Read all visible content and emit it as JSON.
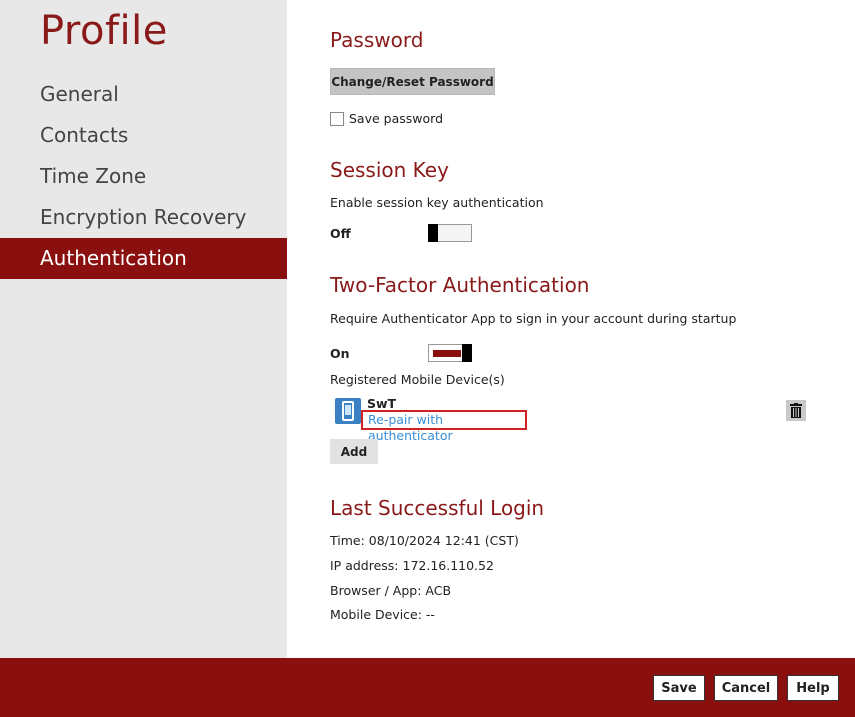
{
  "sidebar": {
    "title": "Profile",
    "items": [
      {
        "label": "General"
      },
      {
        "label": "Contacts"
      },
      {
        "label": "Time Zone"
      },
      {
        "label": "Encryption Recovery"
      },
      {
        "label": "Authentication",
        "active": true
      }
    ]
  },
  "password": {
    "title": "Password",
    "change_button": "Change/Reset Password",
    "save_password_label": "Save password",
    "save_password_checked": false
  },
  "session_key": {
    "title": "Session Key",
    "description": "Enable session key authentication",
    "state_label": "Off",
    "enabled": false
  },
  "two_factor": {
    "title": "Two-Factor Authentication",
    "description": "Require Authenticator App to sign in your account during startup",
    "state_label": "On",
    "enabled": true,
    "devices_label": "Registered Mobile Device(s)",
    "device": {
      "name": "SwT",
      "repair_link": "Re-pair with authenticator",
      "icon": "mobile-phone-icon"
    },
    "add_button": "Add",
    "delete_icon": "trash-icon"
  },
  "last_login": {
    "title": "Last Successful Login",
    "time": "Time: 08/10/2024 12:41 (CST)",
    "ip": "IP address: 172.16.110.52",
    "browser": "Browser / App: ACB",
    "mobile": "Mobile Device: --"
  },
  "footer": {
    "save": "Save",
    "cancel": "Cancel",
    "help": "Help"
  },
  "colors": {
    "accent": "#8a1010",
    "sidebar_bg": "#e8e8e8",
    "link": "#3a8fd8",
    "highlight": "#d02020"
  }
}
